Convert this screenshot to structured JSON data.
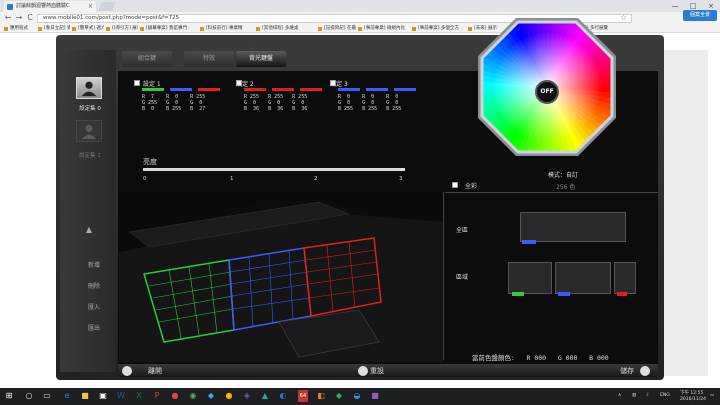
{
  "browser": {
    "tab_title": "討論餘韻迴響熱血體驗C",
    "tab_close": "×",
    "back": "←",
    "forward": "→",
    "reload": "C",
    "url": "www.mobile01.com/post.php?mode=post&f=725",
    "star": "☆",
    "menu": "≡",
    "min": "—",
    "max": "□",
    "close": "×",
    "bookmarks": [
      "應用程式",
      "[春日立記] 異鏈之窗",
      "[簡單式] 週六的春小",
      "[[導引方] 展示",
      "[銀幕專案] 我是專門",
      "[科技前行] 專業精",
      "[其他排程] 多維桌",
      "[記提目記] 在最前往",
      "[事前專業] 微規內化",
      "[事前專案] 多個全方",
      "[未來] 展示",
      "[專題] 自已服裝",
      "[其他] 多行展覽"
    ],
    "right_tab": "個案全景"
  },
  "app": {
    "tabs": [
      "組合鍵",
      "特效",
      "背光鍵盤"
    ],
    "profiles": [
      {
        "label": "設定集 0"
      },
      {
        "label": "設定集 1"
      }
    ],
    "side_buttons": [
      "新增",
      "刪除",
      "匯入",
      "匯出"
    ],
    "side_up": "▲",
    "side_down": "▼",
    "settings": [
      {
        "label": "設定 1",
        "colors": [
          "#2ecc40",
          "#3a5cff",
          "#e02020"
        ],
        "rows": [
          "R  7    R  0    R 255",
          "G 255   G  0    G  0 ",
          "B  0    B 255   B  27"
        ]
      },
      {
        "label": "設定 2",
        "colors": [
          "#e02020",
          "#e02020",
          "#e02020"
        ],
        "rows": [
          "R 255   R 255   R 255",
          "G  0    G  0    G  0 ",
          "B  36   B  36   B  36"
        ]
      },
      {
        "label": "設定 3",
        "colors": [
          "#3a5cff",
          "#3a5cff",
          "#3a5cff"
        ],
        "rows": [
          "R  0    R  0    R  0 ",
          "G  0    G  0    G  0 ",
          "B 255   B 255   B 255"
        ]
      }
    ],
    "brightness_label": "亮度",
    "brightness_ticks": [
      "0",
      "1",
      "2",
      "3"
    ],
    "brightness_value": 3,
    "off_button": "OFF",
    "mode_label": "模式：自訂",
    "full_color_label": "全彩",
    "colors_count": "256 色",
    "zone_all_label": "全區",
    "zone_region_label": "區域",
    "current_color_label": "當前色盤顏色:",
    "current_color": {
      "R": "000",
      "G": "000",
      "B": "000"
    },
    "bottom": {
      "exit": "離開",
      "reset": "重設",
      "save": "儲存"
    },
    "accent_colors": {
      "green": "#2ecc40",
      "blue": "#3a5cff",
      "red": "#e02020"
    }
  },
  "taskbar": {
    "start": "⊞",
    "lang": "ENG",
    "time": "下午 12:55",
    "date": "2016/11/24",
    "tray_up": "∧",
    "badge": "64"
  }
}
